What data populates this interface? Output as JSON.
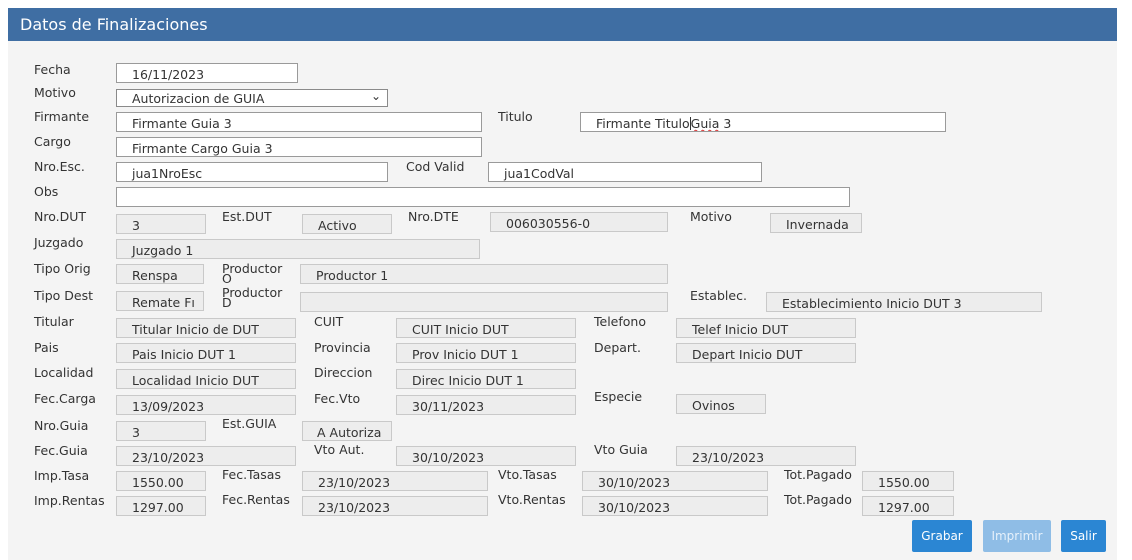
{
  "window": {
    "title": "Datos de Finalizaciones"
  },
  "labels": {
    "fecha": "Fecha",
    "motivo": "Motivo",
    "firmante": "Firmante",
    "titulo": "Titulo",
    "cargo": "Cargo",
    "nro_esc": "Nro.Esc.",
    "cod_valid": "Cod Valid",
    "obs": "Obs",
    "nro_dut": "Nro.DUT",
    "est_dut": "Est.DUT",
    "nro_dte": "Nro.DTE",
    "motivo2": "Motivo",
    "juzgado": "Juzgado",
    "tipo_orig": "Tipo Orig",
    "productor_o": "Productor O",
    "tipo_dest": "Tipo Dest",
    "productor_d": "Productor D",
    "establec": "Establec.",
    "titular": "Titular",
    "cuit": "CUIT",
    "telefono": "Telefono",
    "pais": "Pais",
    "provincia": "Provincia",
    "depart": "Depart.",
    "localidad": "Localidad",
    "direccion": "Direccion",
    "fec_carga": "Fec.Carga",
    "fec_vto": "Fec.Vto",
    "especie": "Especie",
    "nro_guia": "Nro.Guia",
    "est_guia": "Est.GUIA",
    "fec_guia": "Fec.Guia",
    "vto_aut": "Vto Aut.",
    "vto_guia": "Vto Guia",
    "imp_tasa": "Imp.Tasa",
    "fec_tasas": "Fec.Tasas",
    "vto_tasas": "Vto.Tasas",
    "tot_pagado_1": "Tot.Pagado",
    "imp_rentas": "Imp.Rentas",
    "fec_rentas": "Fec.Rentas",
    "vto_rentas": "Vto.Rentas",
    "tot_pagado_2": "Tot.Pagado"
  },
  "values": {
    "fecha": "16/11/2023",
    "motivo": "Autorizacion de GUIA",
    "firmante": "Firmante Guia 3",
    "titulo_before_cursor": "Firmante Titulo",
    "titulo_after_cursor": "Guia",
    "titulo_tail": " 3",
    "cargo": "Firmante Cargo Guia 3",
    "nro_esc": "jua1NroEsc",
    "cod_valid": "jua1CodVal",
    "obs": "",
    "nro_dut": "3",
    "est_dut": "Activo",
    "nro_dte": "006030556-0",
    "motivo2": "Invernada",
    "juzgado": "Juzgado 1",
    "tipo_orig": "Renspa",
    "productor_o": "Productor 1",
    "tipo_dest": "Remate Fı",
    "productor_d": "",
    "establec": "Establecimiento Inicio DUT 3",
    "titular": "Titular Inicio de DUT",
    "cuit": "CUIT Inicio DUT",
    "telefono": "Telef Inicio DUT",
    "pais": "Pais Inicio DUT 1",
    "provincia": "Prov Inicio DUT 1",
    "depart": "Depart Inicio DUT",
    "localidad": "Localidad Inicio DUT",
    "direccion": "Direc Inicio DUT 1",
    "fec_carga": "13/09/2023",
    "fec_vto": "30/11/2023",
    "especie": "Ovinos",
    "nro_guia": "3",
    "est_guia": "A Autoriza",
    "fec_guia": "23/10/2023",
    "vto_aut": "30/10/2023",
    "vto_guia": "23/10/2023",
    "imp_tasa": "1550.00",
    "fec_tasas": "23/10/2023",
    "vto_tasas": "30/10/2023",
    "tot_pagado_1": "1550.00",
    "imp_rentas": "1297.00",
    "fec_rentas": "23/10/2023",
    "vto_rentas": "30/10/2023",
    "tot_pagado_2": "1297.00"
  },
  "buttons": {
    "grabar": "Grabar",
    "imprimir": "Imprimir",
    "salir": "Salir"
  },
  "colors": {
    "titlebar": "#3f6ea3",
    "button": "#2b86d3",
    "button_disabled": "#8fbde6"
  }
}
